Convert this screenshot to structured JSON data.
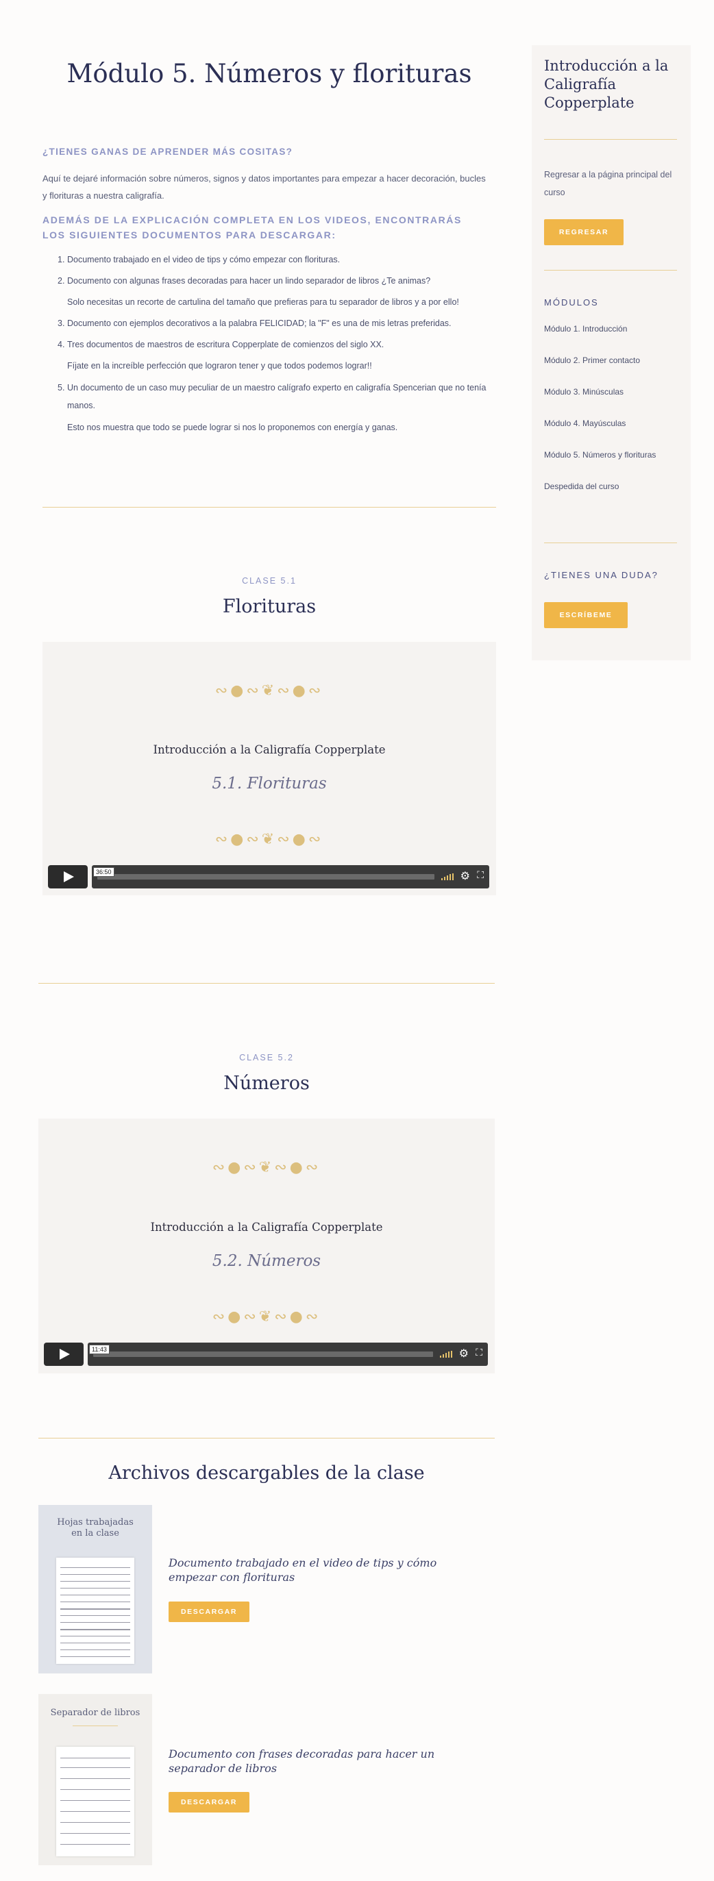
{
  "main": {
    "title": "Módulo 5. Números y florituras",
    "intro_question": "¿TIENES GANAS DE APRENDER MÁS COSITAS?",
    "intro_text": "Aquí te dejaré información sobre números, signos y datos importantes para empezar a hacer decoración, bucles y florituras a nuestra caligrafía.",
    "download_heading": "ADEMÁS DE LA EXPLICACIÓN COMPLETA EN LOS VIDEOS, ENCONTRARÁS LOS SIGUIENTES DOCUMENTOS PARA DESCARGAR:",
    "documents": [
      {
        "num": "1.",
        "text": "Documento trabajado en el video de tips y cómo empezar con florituras.",
        "note": ""
      },
      {
        "num": "2.",
        "text": "Documento con algunas frases decoradas para hacer un lindo separador de libros ¿Te animas?",
        "note": "Solo necesitas un recorte de cartulina del tamaño que prefieras para tu separador de libros y a por ello!"
      },
      {
        "num": "3.",
        "text": "Documento con ejemplos decorativos a la palabra FELICIDAD; la \"F\" es una de mis letras preferidas.",
        "note": ""
      },
      {
        "num": "4.",
        "text": "Tres documentos de maestros de escritura Copperplate de comienzos del siglo XX.",
        "note": "Fíjate en la increíble perfección que lograron tener y que todos podemos lograr!!"
      },
      {
        "num": "5.",
        "text": "Un documento de un caso muy peculiar de un maestro calígrafo experto en caligrafía Spencerian que no tenía manos.",
        "note": "Esto nos muestra que todo se puede lograr si nos lo proponemos con energía y ganas."
      }
    ]
  },
  "classes": [
    {
      "label": "CLASE 5.1",
      "title": "Florituras",
      "video_course": "Introducción a la Caligrafía Copperplate",
      "video_subtitle": "5.1. Florituras",
      "time": "36:50"
    },
    {
      "label": "CLASE 5.2",
      "title": "Números",
      "video_course": "Introducción a la Caligrafía Copperplate",
      "video_subtitle": "5.2. Números",
      "time": "11:43"
    }
  ],
  "files": {
    "title": "Archivos descargables de la clase",
    "items": [
      {
        "thumb_label": "Hojas trabajadas en la clase",
        "description": "Documento trabajado en el video de tips y cómo empezar con florituras",
        "button": "DESCARGAR"
      },
      {
        "thumb_label": "Separador de libros",
        "description": "Documento con frases decoradas para hacer un separador de libros",
        "button": "DESCARGAR"
      }
    ]
  },
  "sidebar": {
    "title": "Introducción a la Caligrafía Copperplate",
    "back_text": "Regresar a la página principal del curso",
    "back_button": "REGRESAR",
    "modules_heading": "MÓDULOS",
    "modules": [
      "Módulo 1. Introducción",
      "Módulo 2. Primer contacto",
      "Módulo 3. Minúsculas",
      "Módulo 4. Mayúsculas",
      "Módulo 5. Números y florituras",
      "Despedida del curso"
    ],
    "question_heading": "¿TIENES UNA DUDA?",
    "contact_button": "ESCRÍBEME"
  },
  "colors": {
    "accent": "#f0b648",
    "heading": "#2b2f55",
    "label": "#8d94c4",
    "gold_rule": "#e8cf95"
  }
}
